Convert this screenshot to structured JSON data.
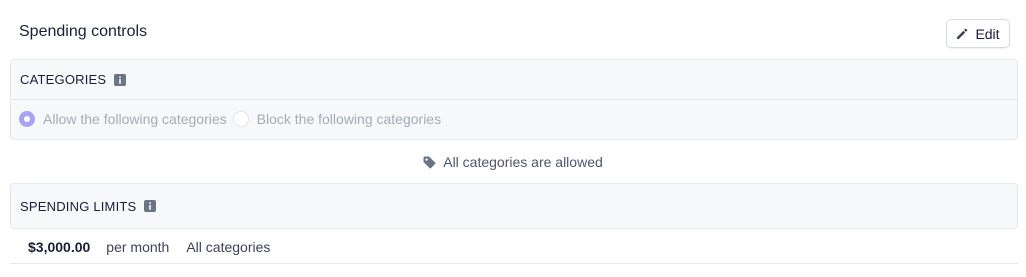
{
  "header": {
    "title": "Spending controls",
    "edit_label": "Edit"
  },
  "categories": {
    "label": "CATEGORIES",
    "options": [
      {
        "label": "Allow the following categories",
        "selected": true
      },
      {
        "label": "Block the following categories",
        "selected": false
      }
    ],
    "status_text": "All categories are allowed",
    "status_icon": "tag-icon"
  },
  "spending_limits": {
    "label": "SPENDING LIMITS",
    "rows": [
      {
        "amount": "$3,000.00",
        "period": "per month",
        "scope": "All categories"
      }
    ]
  },
  "colors": {
    "radio_accent": "#a8a4f5",
    "panel_bg": "#f6f8fa",
    "border": "#e3e8ee",
    "text_primary": "#1a1f36",
    "text_disabled": "#a3acb9"
  }
}
